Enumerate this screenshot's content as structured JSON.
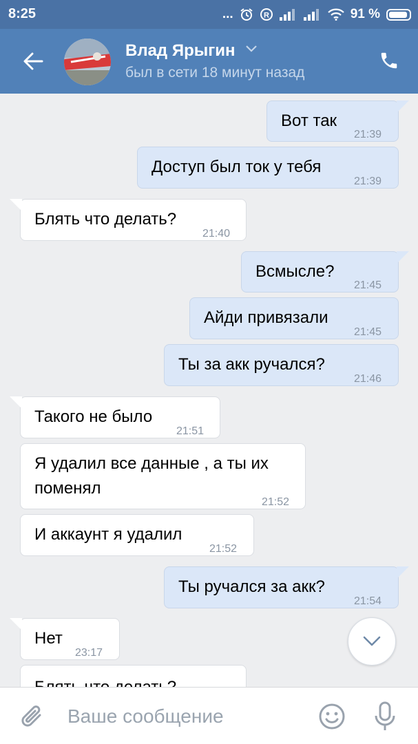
{
  "status_bar": {
    "time": "8:25",
    "dots": "...",
    "battery_percent": "91 %"
  },
  "header": {
    "contact_name": "Влад Ярыгин",
    "contact_status": "был в сети 18 минут назад"
  },
  "messages": [
    {
      "dir": "out",
      "text": "Вот так",
      "time": "21:39"
    },
    {
      "dir": "out",
      "text": "Доступ был ток у тебя",
      "time": "21:39"
    },
    {
      "dir": "in",
      "text": "Блять что делать?",
      "time": "21:40"
    },
    {
      "dir": "out",
      "text": "Всмысле?",
      "time": "21:45"
    },
    {
      "dir": "out",
      "text": "Айди привязали",
      "time": "21:45"
    },
    {
      "dir": "out",
      "text": "Ты за акк ручался?",
      "time": "21:46"
    },
    {
      "dir": "in",
      "text": "Такого не было",
      "time": "21:51"
    },
    {
      "dir": "in",
      "text_line1": "Я удалил все данные , а ты их",
      "text_line2": "поменял",
      "time": "21:52"
    },
    {
      "dir": "in",
      "text": "И аккаунт я удалил",
      "time": "21:52"
    },
    {
      "dir": "out",
      "text": "Ты ручался за акк?",
      "time": "21:54"
    },
    {
      "dir": "in",
      "text": "Нет",
      "time": "23:17"
    },
    {
      "dir": "in",
      "text": "Блять что делать?",
      "time": ""
    }
  ],
  "composer": {
    "placeholder": "Ваше сообщение"
  },
  "colors": {
    "status_bar": "#4a72a5",
    "header": "#5181b8",
    "background": "#edeef0",
    "outgoing_bubble": "#dbe7f8",
    "incoming_bubble": "#ffffff"
  }
}
